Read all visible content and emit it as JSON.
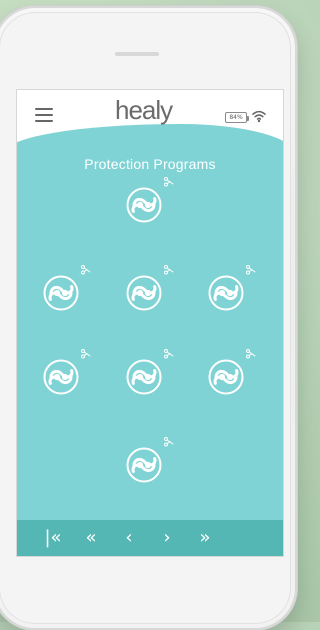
{
  "app": {
    "logo_text": "healy",
    "title": "Protection Programs"
  },
  "status": {
    "battery": "84%",
    "wifi_icon": "wifi-icon"
  },
  "footer": {
    "first_label": "|«",
    "prev_page_label": "«",
    "prev_label": "‹",
    "next_label": "›",
    "next_page_label": "»"
  },
  "colors": {
    "teal": "#7fd3d4",
    "footer": "#54b7b4",
    "logo_gray": "#6b6b6b",
    "white": "#ffffff"
  },
  "programs": [
    {
      "icon": "healy-program-icon"
    },
    {
      "icon": "healy-program-icon"
    },
    {
      "icon": "healy-program-icon"
    },
    {
      "icon": "healy-program-icon"
    },
    {
      "icon": "healy-program-icon"
    },
    {
      "icon": "healy-program-icon"
    },
    {
      "icon": "healy-program-icon"
    },
    {
      "icon": "healy-program-icon"
    }
  ]
}
